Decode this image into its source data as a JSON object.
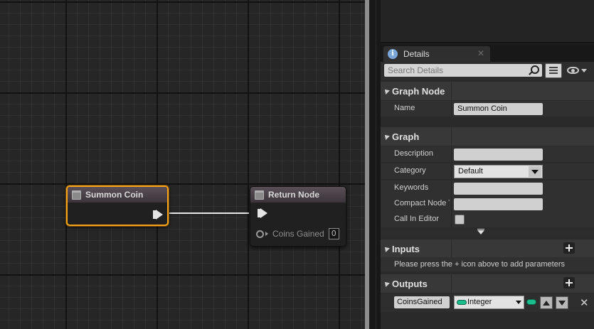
{
  "graph": {
    "summon_node": {
      "title": "Summon Coin"
    },
    "return_node": {
      "title": "Return Node",
      "pin_label": "Coins Gained",
      "pin_value": "0"
    }
  },
  "details": {
    "tab_label": "Details",
    "search_placeholder": "Search Details",
    "graph_node": {
      "title": "Graph Node",
      "name_label": "Name",
      "name_value": "Summon Coin"
    },
    "graph": {
      "title": "Graph",
      "description_label": "Description",
      "category_label": "Category",
      "category_value": "Default",
      "keywords_label": "Keywords",
      "compact_label": "Compact Node Title",
      "call_in_editor_label": "Call In Editor"
    },
    "inputs": {
      "title": "Inputs",
      "hint": "Please press the + icon above to add parameters"
    },
    "outputs": {
      "title": "Outputs",
      "param_name": "CoinsGained",
      "param_type": "Integer"
    }
  },
  "colors": {
    "selection": "#f6a21a",
    "integer_pin": "#1bbd8c"
  },
  "icons": [
    "function-icon",
    "exec-pin-icon",
    "info-icon",
    "search-icon",
    "view-options-icon",
    "eye-icon",
    "plus-icon",
    "arrow-up-icon",
    "arrow-down-icon",
    "delete-icon"
  ]
}
